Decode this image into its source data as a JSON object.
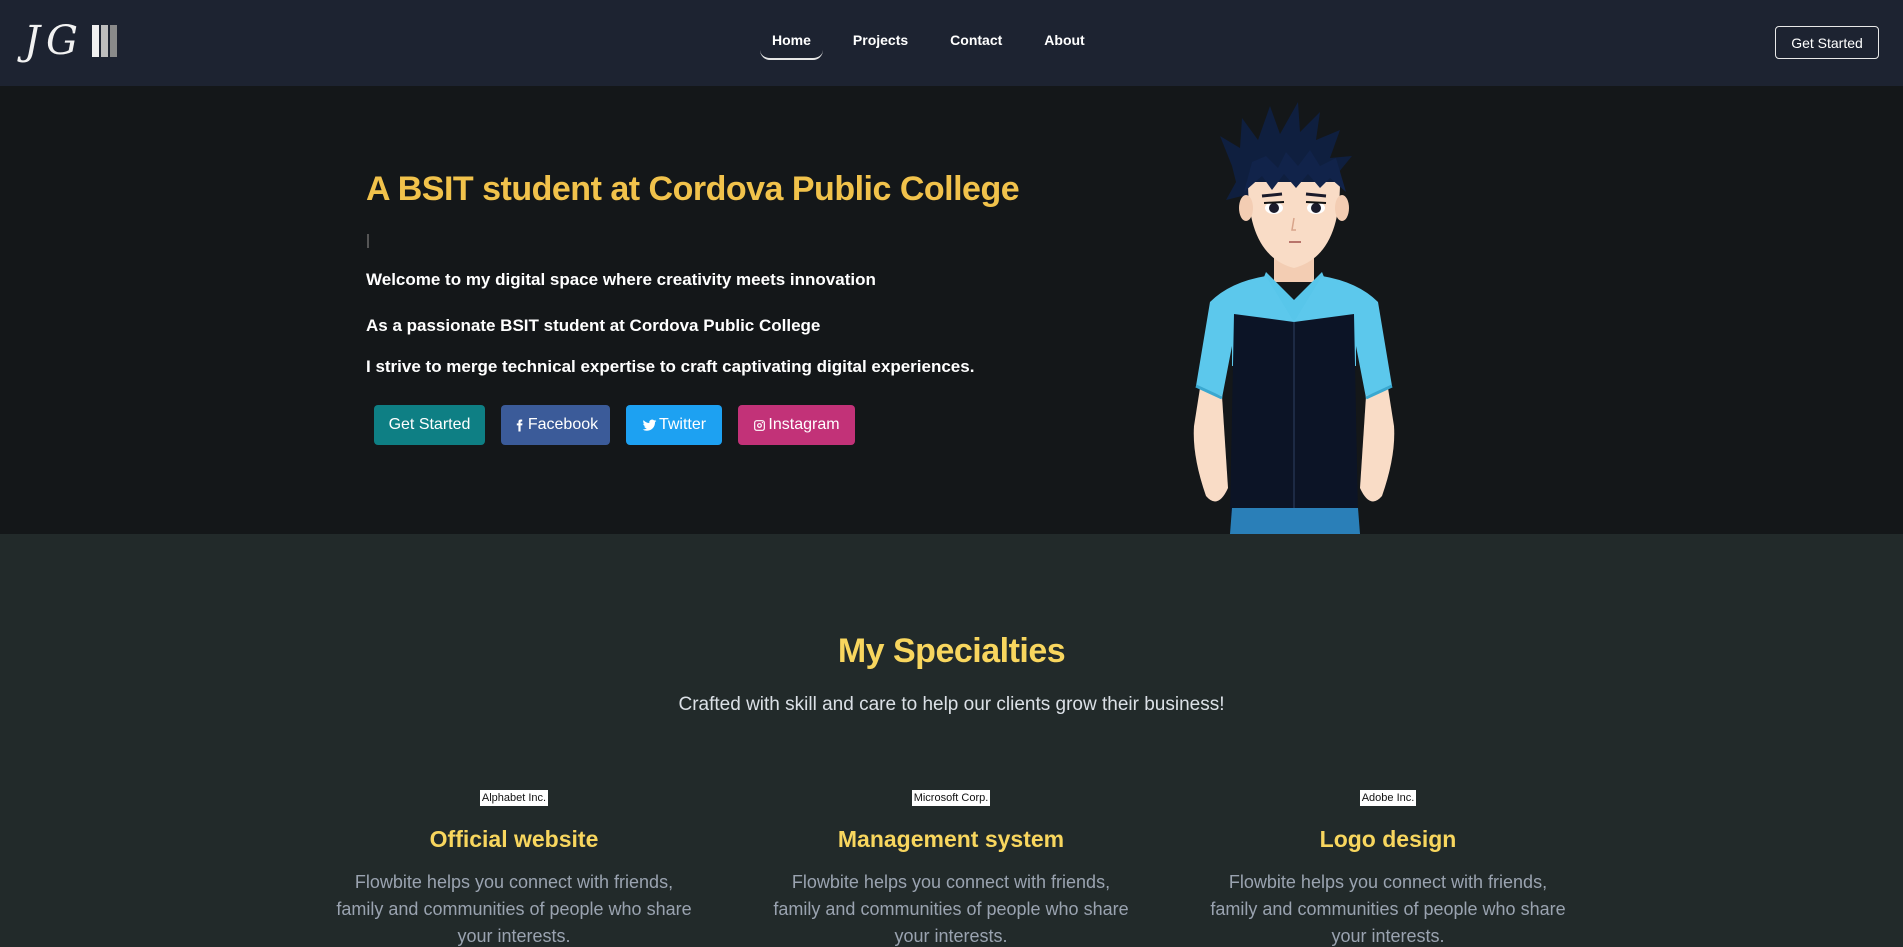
{
  "nav": {
    "logo_text": "JG",
    "links": [
      {
        "label": "Home",
        "active": true
      },
      {
        "label": "Projects",
        "active": false
      },
      {
        "label": "Contact",
        "active": false
      },
      {
        "label": "About",
        "active": false
      }
    ],
    "cta_label": "Get Started"
  },
  "hero": {
    "title": "A BSIT student at Cordova Public College",
    "line1": "Welcome to my digital space where creativity meets innovation",
    "line2": "As a passionate BSIT student at Cordova Public College",
    "line3": "I strive to merge technical expertise to craft captivating digital experiences.",
    "buttons": {
      "start": "Get Started",
      "facebook": "Facebook",
      "twitter": "Twitter",
      "instagram": "Instagram"
    }
  },
  "specialties": {
    "title": "My Specialties",
    "subtitle": "Crafted with skill and care to help our clients grow their business!",
    "cards": [
      {
        "tag": "Alphabet Inc.",
        "title": "Official website",
        "desc": "Flowbite helps you connect with friends, family and communities of people who share your interests."
      },
      {
        "tag": "Microsoft Corp.",
        "title": "Management system",
        "desc": "Flowbite helps you connect with friends, family and communities of people who share your interests."
      },
      {
        "tag": "Adobe Inc.",
        "title": "Logo design",
        "desc": "Flowbite helps you connect with friends, family and communities of people who share your interests."
      }
    ]
  },
  "colors": {
    "navbar_bg": "#1d2331",
    "hero_bg": "#141719",
    "section_bg": "#222a2a",
    "heading_accent": "#f1c24b",
    "specialty_accent": "#f8d65e",
    "btn_start": "#0e7f84",
    "btn_facebook": "#3b5b99",
    "btn_twitter": "#1da1f2",
    "btn_instagram": "#c23278"
  },
  "icons": {
    "facebook": "facebook-icon",
    "twitter": "twitter-icon",
    "instagram": "instagram-icon"
  }
}
